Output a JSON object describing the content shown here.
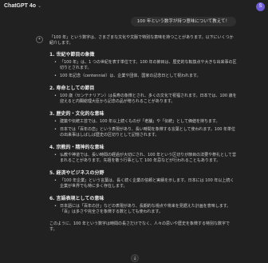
{
  "topbar": {
    "model": "ChatGPT 4o",
    "caret": "⌄",
    "avatar": "S"
  },
  "user_message": "100 年という数字が持つ意味について教えて！",
  "assistant": {
    "icon": "✦",
    "intro": "「100 年」という数字は、さまざまな文化や文脈で特別な意味を持つことがあります。以下にいくつか紹介します。",
    "sections": [
      {
        "title": "1. 世紀や節目の象徴",
        "bullets": [
          "「100 年」は、1 つの世紀を表す単位です。100 年の節目は、歴史的な転換点や大きな出来事の区切りとされます。",
          "100 年記念（centennial）は、企業や団体、国家の記念日として祝われます。"
        ]
      },
      {
        "title": "2. 寿命としての節目",
        "bullets": [
          "100 歳（センテナリアン）は長寿の象徴とされ、多くの文化で祝福されます。日本では、100 歳を迎えると内閣総理大臣から記念の品が贈られることがあります。"
        ]
      },
      {
        "title": "3. 歴史的・文化的な意味",
        "bullets": [
          "建築や伝統工芸では、100 年以上続くものが「老舗」や「伝統」として価値を持ちます。",
          "日本では「百年の恋」という表現があり、長い時間を象徴する言葉として使われます。100 年単位の出来事はしばしば歴史の区切りとして記憶されます。"
        ]
      },
      {
        "title": "4. 宗教的・精神的な意味",
        "bullets": [
          "仏教や神道では、長い時間の経過が大切にされ、100 年という区切りが節目の法要や祭礼として営まれることがあります。先祖を敬う行事として 100 年忌などが行われることもあります。"
        ]
      },
      {
        "title": "5. 経済やビジネスの分野",
        "bullets": [
          "「100 年企業」という言葉は、長く続く企業の信頼と実績を示します。日本には 100 年以上続く企業が世界でも特に多く存在します。"
        ]
      },
      {
        "title": "6. 言語表現としての意味",
        "bullets": [
          "日本語には「百年の計」などの表現があり、長期的な視点や将来を見据えた計画を意味します。「百」は多さや完全さを象徴する数としても使われます。"
        ]
      }
    ],
    "outro": "このように、100 年という数字は時間の長さだけでなく、人々の思いや歴史を象徴する特別な数字です。"
  },
  "scroll_button": "↓"
}
